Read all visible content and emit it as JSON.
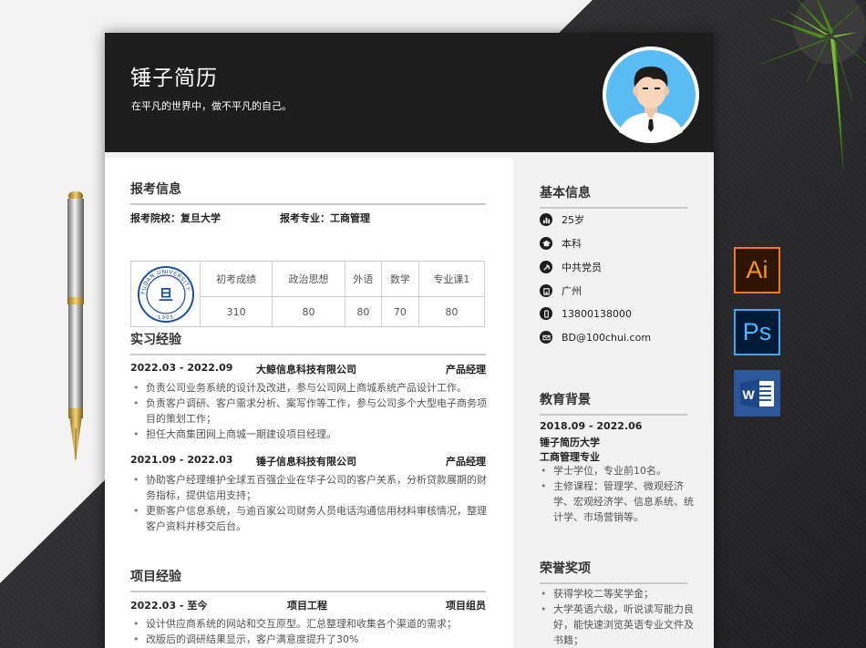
{
  "resume": {
    "title": "锤子简历",
    "motto": "在平凡的世界中，做不平凡的自己。"
  },
  "exam": {
    "section_title": "报考信息",
    "school": "报考院校：复旦大学",
    "major": "报考专业：工商管理",
    "score_headers": [
      "初考成绩",
      "政治思想",
      "外语",
      "数学",
      "专业课1"
    ],
    "score_values": [
      "310",
      "80",
      "80",
      "70",
      "80"
    ],
    "logo_text": "FUDAN UNIVERSITY",
    "logo_year": "1905"
  },
  "internship": {
    "section_title": "实习经验",
    "entries": [
      {
        "period": "2022.03 - 2022.09",
        "company": "大鲸信息科技有限公司",
        "role": "产品经理",
        "bullets": [
          "负责公司业务系统的设计及改进，参与公司网上商城系统产品设计工作。",
          "负责客户调研、客户需求分析、案写作等工作，参与公司多个大型电子商务项目的策划工作；",
          "担任大商集团网上商城一期建设项目经理。"
        ]
      },
      {
        "period": "2021.09 - 2022.03",
        "company": "锤子信息科技有限公司",
        "role": "产品经理",
        "bullets": [
          "协助客户经理维护全球五百强企业在华子公司的客户关系，分析贷款展期的财务指标，提供信用支持；",
          "更新客户信息系统，与逾百家公司财务人员电话沟通信用材料审核情况，整理客户资料并移交后台。"
        ]
      }
    ]
  },
  "project": {
    "section_title": "项目经验",
    "entries": [
      {
        "period": "2022.03 - 至今",
        "company": "项目工程",
        "role": "项目组员",
        "bullets": [
          "设计供应商系统的网站和交互原型。汇总整理和收集各个渠道的需求；",
          "改版后的调研结果显示，客户满意度提升了30%"
        ]
      }
    ]
  },
  "basic_info": {
    "section_title": "基本信息",
    "items": [
      {
        "icon": "chart-icon",
        "text": "25岁"
      },
      {
        "icon": "graduation-cap-icon",
        "text": "本科"
      },
      {
        "icon": "party-emblem-icon",
        "text": "中共党员"
      },
      {
        "icon": "building-icon",
        "text": "广州"
      },
      {
        "icon": "phone-icon",
        "text": "13800138000"
      },
      {
        "icon": "mail-icon",
        "text": "BD@100chui.com"
      }
    ]
  },
  "education": {
    "section_title": "教育背景",
    "period": "2018.09 - 2022.06",
    "school": "锤子简历大学",
    "major": "工商管理专业",
    "bullets": [
      "学士学位，专业前10名。",
      "主修课程：管理学、微观经济学、宏观经济学、信息系统、统计学、市场营销等。"
    ]
  },
  "honors": {
    "section_title": "荣誉奖项",
    "bullets": [
      "获得学校二等奖学金；",
      "大学英语六级，听说读写能力良好，能快速浏览英语专业文件及书籍；"
    ]
  },
  "apps": {
    "ai": "Ai",
    "ps": "Ps"
  },
  "colors": {
    "header": "#1e1d1e",
    "sidebar": "#f2f2f2",
    "avatar_bg": "#5bbcf3",
    "ai_orange": "#f7961e",
    "ps_blue": "#48b7ff",
    "word_blue": "#2b579a"
  }
}
